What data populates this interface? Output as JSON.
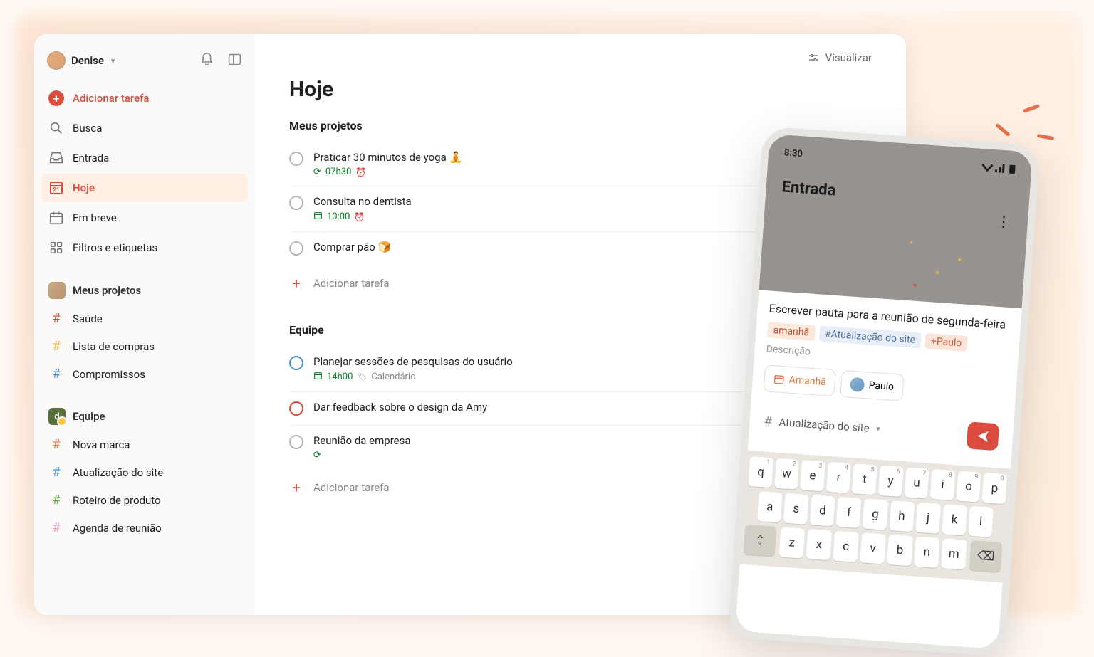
{
  "user": {
    "name": "Denise"
  },
  "sidebar": {
    "add_task": "Adicionar tarefa",
    "search": "Busca",
    "inbox": "Entrada",
    "today": "Hoje",
    "upcoming": "Em breve",
    "filters": "Filtros e etiquetas",
    "my_projects_label": "Meus projetos",
    "projects": [
      {
        "label": "Saúde",
        "color": "red"
      },
      {
        "label": "Lista de compras",
        "color": "yellow"
      },
      {
        "label": "Compromissos",
        "color": "blue"
      }
    ],
    "team_label": "Equipe",
    "team_initial": "d",
    "team_projects": [
      {
        "label": "Nova marca",
        "color": "orange"
      },
      {
        "label": "Atualização do site",
        "color": "blue"
      },
      {
        "label": "Roteiro de produto",
        "color": "green"
      },
      {
        "label": "Agenda de reunião",
        "color": "pink"
      }
    ]
  },
  "main": {
    "view_button": "Visualizar",
    "title": "Hoje",
    "group1_title": "Meus projetos",
    "group1_tasks": [
      {
        "title": "Praticar 30 minutos de yoga 🧘",
        "time": "07h30",
        "recurring": true,
        "alarm": true
      },
      {
        "title": "Consulta no dentista",
        "time": "10:00",
        "calendar": true,
        "alarm": true
      },
      {
        "title": "Comprar pão 🍞"
      }
    ],
    "add_task_label": "Adicionar tarefa",
    "group2_title": "Equipe",
    "group2_tasks": [
      {
        "title": "Planejar sessões de pesquisas do usuário",
        "time": "14h00",
        "calendar": true,
        "cal_label": "Calendário",
        "priority": "blue"
      },
      {
        "title": "Dar feedback sobre o design da Amy",
        "priority": "red"
      },
      {
        "title": "Reunião da empresa",
        "recurring": true
      }
    ]
  },
  "phone": {
    "time": "8:30",
    "header": "Entrada",
    "task_text": "Escrever pauta para a reunião de segunda-feira",
    "chip_due": "amanhã",
    "chip_project": "#Atualização do site",
    "chip_assignee": "+Paulo",
    "description_placeholder": "Descrição",
    "pill_due": "Amanhã",
    "pill_assignee": "Paulo",
    "project_selector": "Atualização do site",
    "keyboard_rows": [
      [
        "q",
        "w",
        "e",
        "r",
        "t",
        "y",
        "u",
        "i",
        "o",
        "p"
      ],
      [
        "a",
        "s",
        "d",
        "f",
        "g",
        "h",
        "j",
        "k",
        "l"
      ],
      [
        "z",
        "x",
        "c",
        "v",
        "b",
        "n",
        "m"
      ]
    ],
    "key_numbers": [
      "1",
      "2",
      "3",
      "4",
      "5",
      "6",
      "7",
      "8",
      "9",
      "0"
    ]
  }
}
